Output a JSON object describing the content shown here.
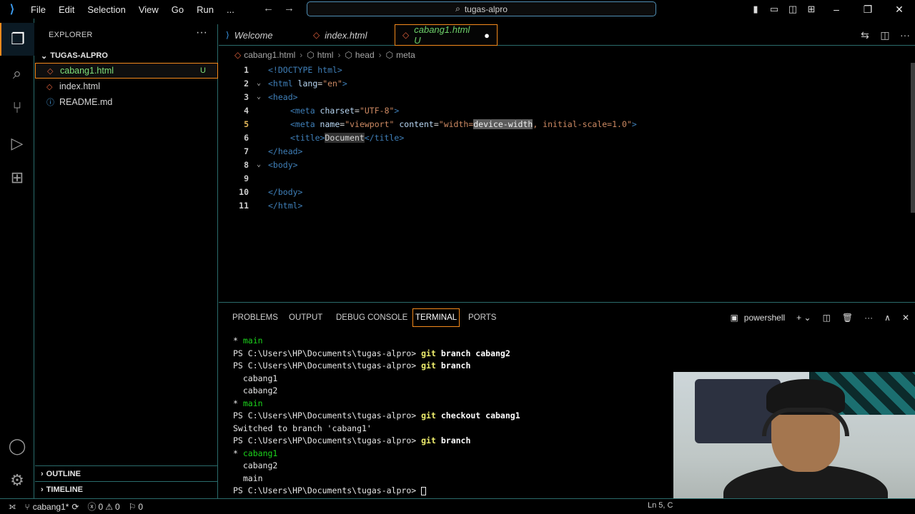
{
  "menu": [
    "File",
    "Edit",
    "Selection",
    "View",
    "Go",
    "Run",
    "..."
  ],
  "search": {
    "text": "tugas-alpro"
  },
  "sidebar": {
    "title": "EXPLORER",
    "folder": "TUGAS-ALPRO",
    "files": [
      {
        "name": "cabang1.html",
        "badge": "U"
      },
      {
        "name": "index.html",
        "badge": ""
      },
      {
        "name": "README.md",
        "badge": ""
      }
    ],
    "outline": "OUTLINE",
    "timeline": "TIMELINE"
  },
  "tabs": [
    {
      "label": "Welcome"
    },
    {
      "label": "index.html"
    },
    {
      "label": "cabang1.html U"
    }
  ],
  "breadcrumb": [
    "cabang1.html",
    "html",
    "head",
    "meta"
  ],
  "editor": {
    "lines": [
      "1",
      "2",
      "3",
      "4",
      "5",
      "6",
      "7",
      "8",
      "9",
      "10",
      "11"
    ],
    "c1": "<!DOCTYPE html>",
    "c2a": "<html ",
    "c2b": "lang",
    "c2c": "=",
    "c2d": "\"en\"",
    "c2e": ">",
    "c3": "<head>",
    "c4a": "<meta ",
    "c4b": "charset",
    "c4c": "=",
    "c4d": "\"UTF-8\"",
    "c4e": ">",
    "c5a": "<meta ",
    "c5b": "name",
    "c5c": "=",
    "c5d": "\"viewport\"",
    "c5e": " content",
    "c5f": "=",
    "c5g": "\"width=",
    "c5h": "device-width",
    "c5i": ", initial-scale=1.0\"",
    "c5j": ">",
    "c6a": "<title>",
    "c6b": "Document",
    "c6c": "</title>",
    "c7": "</head>",
    "c8": "<body>",
    "c10": "</body>",
    "c11": "</html>"
  },
  "panel": {
    "tabs": [
      "PROBLEMS",
      "OUTPUT",
      "DEBUG CONSOLE",
      "TERMINAL",
      "PORTS"
    ],
    "shell": "powershell"
  },
  "terminal": {
    "prompt": "PS C:\\Users\\HP\\Documents\\tugas-alpro>",
    "star": "*",
    "main": "main",
    "cabang1": "cabang1",
    "cabang2": "cabang2",
    "git": "git",
    "cmd_branch_cabang2": "branch cabang2",
    "cmd_branch": "branch",
    "cmd_checkout": "checkout cabang1",
    "switched": "Switched to branch 'cabang1'"
  },
  "statusbar": {
    "branch": "cabang1*",
    "errors": "0",
    "warnings": "0",
    "ports": "0",
    "position": "Ln 5, C"
  }
}
